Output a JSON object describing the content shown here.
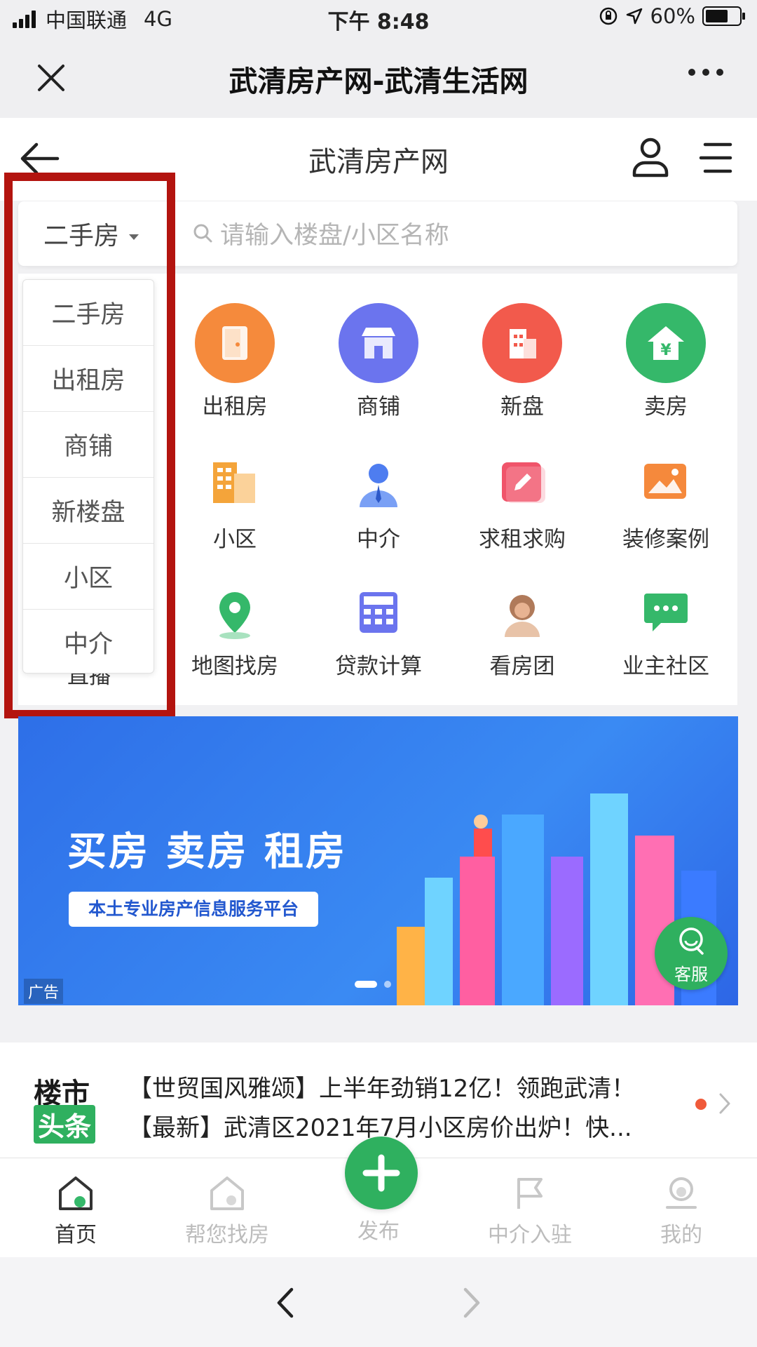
{
  "status_bar": {
    "carrier": "中国联通",
    "network": "4G",
    "time": "下午 8:48",
    "battery": "60%"
  },
  "wechat_bar": {
    "title": "武清房产网-武清生活网"
  },
  "site_header": {
    "title": "武清房产网"
  },
  "search": {
    "category": "二手房",
    "placeholder": "请输入楼盘/小区名称"
  },
  "dropdown": {
    "options": [
      "二手房",
      "出租房",
      "商铺",
      "新楼盘",
      "小区",
      "中介"
    ]
  },
  "grid": {
    "items": [
      {
        "label": "出租房",
        "icon": "door-icon",
        "color": "#f58a3c"
      },
      {
        "label": "商铺",
        "icon": "shop-icon",
        "color": "#6b74ee"
      },
      {
        "label": "新盘",
        "icon": "building-icon",
        "color": "#f25a4c"
      },
      {
        "label": "卖房",
        "icon": "house-yen-icon",
        "color": "#35b86a"
      },
      {
        "label": "小区",
        "icon": "apartments-icon",
        "color": "#f4a43a"
      },
      {
        "label": "中介",
        "icon": "agent-icon",
        "color": "#4e7df0"
      },
      {
        "label": "求租求购",
        "icon": "edit-icon",
        "color": "#f0546a"
      },
      {
        "label": "装修案例",
        "icon": "picture-icon",
        "color": "#f5893c"
      },
      {
        "label": "地图找房",
        "icon": "map-pin-icon",
        "color": "#35b86a"
      },
      {
        "label": "贷款计算",
        "icon": "calculator-icon",
        "color": "#6b74ee"
      },
      {
        "label": "看房团",
        "icon": "person-icon",
        "color": "#b07a5a"
      },
      {
        "label": "业主社区",
        "icon": "chat-icon",
        "color": "#35b86a"
      }
    ],
    "hidden_partial_label": "直播"
  },
  "banner": {
    "headline": "买房 卖房 租房",
    "subline": "本土专业房产信息服务平台",
    "ad_tag": "广告",
    "kefu": "客服"
  },
  "news": {
    "logo_top": "楼市",
    "logo_bottom": "头条",
    "line1": "【世贸国风雅颂】上半年劲销12亿！领跑武清！",
    "line2": "【最新】武清区2021年7月小区房价出炉！快..."
  },
  "tabbar": {
    "tabs": [
      {
        "label": "首页",
        "active": true
      },
      {
        "label": "帮您找房",
        "active": false
      },
      {
        "label": "发布",
        "active": false
      },
      {
        "label": "中介入驻",
        "active": false
      },
      {
        "label": "我的",
        "active": false
      }
    ]
  },
  "colors": {
    "accent_green": "#2fb05f",
    "highlight_red": "#b3140f",
    "banner_blue": "#2e6fe8"
  }
}
